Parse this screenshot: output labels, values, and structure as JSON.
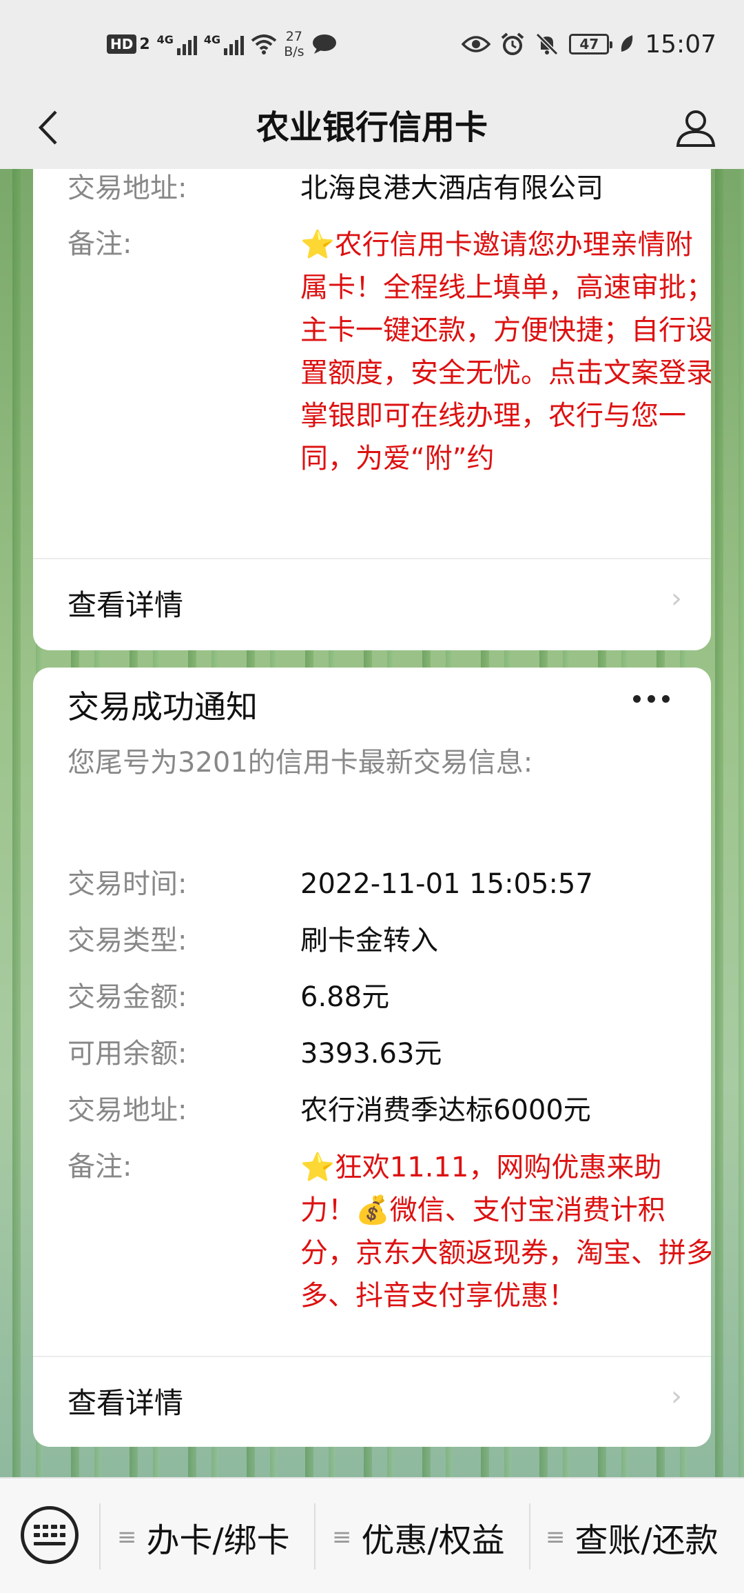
{
  "status_bar": {
    "hd": "HD",
    "sim2": "2",
    "net1": "4G",
    "net2": "4G",
    "speed_value": "27",
    "speed_unit": "B/s",
    "battery": "47",
    "time": "15:07"
  },
  "header": {
    "title": "农业银行信用卡"
  },
  "card1": {
    "rows": [
      {
        "label": "交易地址:",
        "value": "北海良港大酒店有限公司"
      },
      {
        "label": "备注:",
        "value": "⭐农行信用卡邀请您办理亲情附属卡！全程线上填单，高速审批；主卡一键还款，方便快捷；自行设置额度，安全无忧。点击文案登录掌银即可在线办理，农行与您一同，为爱“附”约"
      }
    ],
    "details_label": "查看详情"
  },
  "card2": {
    "title": "交易成功通知",
    "subtitle": "您尾号为3201的信用卡最新交易信息:",
    "rows": [
      {
        "label": "交易时间:",
        "value": "2022-11-01 15:05:57"
      },
      {
        "label": "交易类型:",
        "value": "刷卡金转入"
      },
      {
        "label": "交易金额:",
        "value": "6.88元"
      },
      {
        "label": "可用余额:",
        "value": "3393.63元"
      },
      {
        "label": "交易地址:",
        "value": "农行消费季达标6000元"
      },
      {
        "label": "备注:",
        "value": "⭐狂欢11.11，网购优惠来助力！💰微信、支付宝消费计积分，京东大额返现券，淘宝、拼多多、抖音支付享优惠！"
      }
    ],
    "details_label": "查看详情"
  },
  "bottom_menu": {
    "items": [
      {
        "label": "办卡/绑卡"
      },
      {
        "label": "优惠/权益"
      },
      {
        "label": "查账/还款"
      }
    ]
  },
  "colors": {
    "remark_red": "#d11111",
    "background": "#ededed"
  }
}
